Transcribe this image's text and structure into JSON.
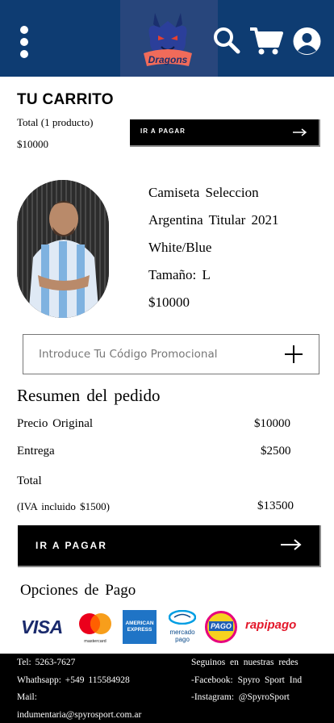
{
  "header": {
    "menu_icon": "kebab-menu-icon",
    "logo_text": "Dragons",
    "icons": [
      "search-icon",
      "cart-icon",
      "user-icon"
    ],
    "brand_color": "#0e3c72"
  },
  "cart": {
    "title": "TU CARRITO",
    "count_label": "Total (1 producto)",
    "total": "$10000",
    "pay_button": "IR A PAGAR"
  },
  "product": {
    "name_line1": "Camiseta Seleccion",
    "name_line2": "Argentina Titular 2021",
    "name_line3": "White/Blue",
    "size": "Tamaño: L",
    "price": "$10000"
  },
  "promo": {
    "placeholder": "Introduce Tu Código Promocional"
  },
  "summary": {
    "title": "Resumen del pedido",
    "original_label": "Precio Original",
    "original_value": "$10000",
    "delivery_label": "Entrega",
    "delivery_value": "$2500",
    "total_label": "Total",
    "iva_label": "(IVA incluido $1500)",
    "total_value": "$13500",
    "pay_button": "IR A PAGAR"
  },
  "payment": {
    "title": "Opciones de Pago",
    "visa": "VISA",
    "mastercard": "mastercard",
    "amex_line1": "AMERICAN",
    "amex_line2": "EXPRESS",
    "mercadopago_line1": "mercado",
    "mercadopago_line2": "pago",
    "pagofacil": "PAGO",
    "rapipago": "rapipago"
  },
  "footer": {
    "tel": "Tel: 5263-7627",
    "whatsapp": "Whathsapp: +549 115584928",
    "mail_label": "Mail:",
    "mail": "indumentaria@spyrosport.com.ar",
    "social_title": "Seguinos en nuestras redes",
    "facebook": "-Facebook: Spyro Sport Ind",
    "instagram": "-Instagram: @SpyroSport"
  }
}
